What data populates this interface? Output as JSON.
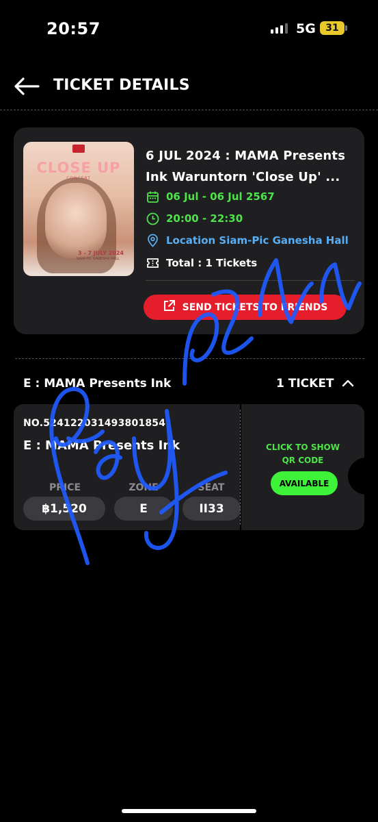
{
  "status_bar": {
    "time": "20:57",
    "network": "5G",
    "battery": "31"
  },
  "header": {
    "title": "TICKET DETAILS",
    "back_icon": "arrow-left-icon"
  },
  "event": {
    "title_line1": "6 JUL 2024 : MAMA Presents",
    "title_line2": "Ink Waruntorn 'Close Up' ...",
    "date_range": "06 Jul - 06 Jul 2567",
    "time_range": "20:00 - 22:30",
    "location": "Location Siam-Pic Ganesha Hall",
    "total": "Total : 1 Tickets",
    "send_button": "SEND TICKETS TO FRIENDS",
    "poster": {
      "title": "CLOSE UP",
      "subtitle": "CONCERT",
      "dates": "3 - 7 JULY 2024",
      "venue": "SIAM-PIC GANESHA HALL"
    },
    "colors": {
      "accent_green": "#4ee34a",
      "location_blue": "#58aef5",
      "send_red": "#e61e2b"
    }
  },
  "ticket_section": {
    "heading": "E : MAMA Presents Ink",
    "count": "1 TICKET"
  },
  "ticket": {
    "number": "NO.524122031493801854",
    "name": "E : MAMA Presents Ink",
    "price_label": "PRICE",
    "price": "฿1,520",
    "zone_label": "ZONE",
    "zone": "E",
    "seat_label": "SEAT",
    "seat": "II33",
    "qr_line1": "CLICK TO SHOW",
    "qr_line2": "QR CODE",
    "status": "AVAILABLE"
  }
}
